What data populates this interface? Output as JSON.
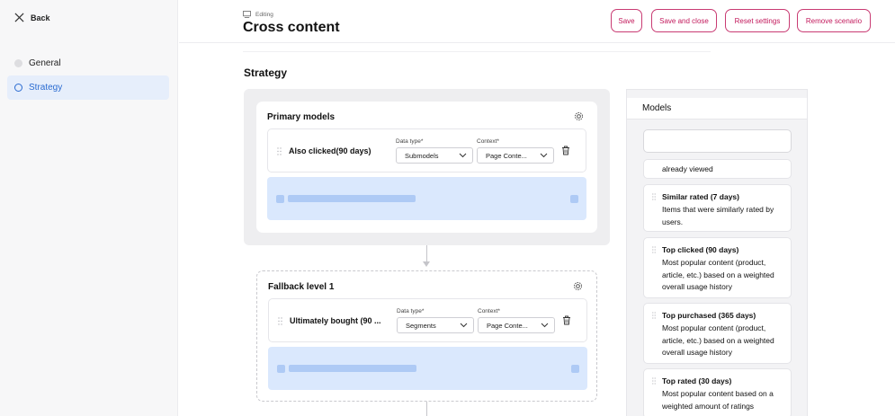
{
  "sidebar": {
    "back_label": "Back",
    "items": [
      {
        "label": "General",
        "active": false
      },
      {
        "label": "Strategy",
        "active": true
      }
    ]
  },
  "header": {
    "editing_label": "Editing",
    "title": "Cross content",
    "buttons": {
      "save": "Save",
      "save_close": "Save and close",
      "reset": "Reset settings",
      "remove": "Remove scenario"
    }
  },
  "strategy": {
    "title": "Strategy",
    "primary": {
      "title": "Primary models",
      "row": {
        "name": "Also clicked(90 days)",
        "data_type_label": "Data type*",
        "data_type_value": "Submodels",
        "context_label": "Context*",
        "context_value": "Page Conte..."
      }
    },
    "fallback": {
      "title": "Fallback level 1",
      "row": {
        "name": "Ultimately bought (90 ...",
        "data_type_label": "Data type*",
        "data_type_value": "Segments",
        "context_label": "Context*",
        "context_value": "Page Conte..."
      }
    }
  },
  "models": {
    "title": "Models",
    "search_value": "",
    "items": [
      {
        "title": "",
        "desc": "already viewed"
      },
      {
        "title": "Similar rated (7 days)",
        "desc": "Items that were similarly rated by users."
      },
      {
        "title": "Top clicked (90 days)",
        "desc": "Most popular content (product, article, etc.) based on a weighted overall usage history"
      },
      {
        "title": "Top purchased (365 days)",
        "desc": "Most popular content (product, article, etc.) based on a weighted overall usage history"
      },
      {
        "title": "Top rated (30 days)",
        "desc": "Most popular content based on a weighted amount of ratings"
      }
    ]
  },
  "colors": {
    "accent": "#c2185b",
    "active_nav": "#2a6bd1",
    "dropzone": "#dae8fd"
  },
  "icons": [
    "close-icon",
    "edit-icon",
    "gear-icon",
    "drag-handle-icon",
    "chevron-down-icon",
    "trash-icon"
  ]
}
